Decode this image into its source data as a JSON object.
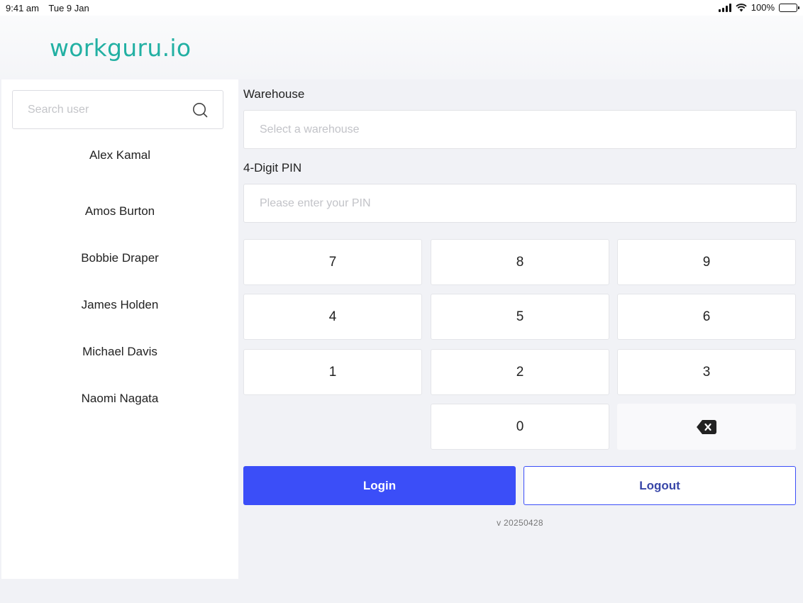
{
  "status_bar": {
    "time": "9:41 am",
    "date": "Tue 9 Jan",
    "battery": "100%",
    "icons": [
      "signal-icon",
      "wifi-icon",
      "battery-icon"
    ]
  },
  "brand": {
    "logo": "workguru.io",
    "accent": "#22b0a3",
    "primary": "#3b4ef8"
  },
  "sidebar": {
    "search_placeholder": "Search user",
    "users": [
      "Alex Kamal",
      "Amos Burton",
      "Bobbie Draper",
      "James Holden",
      "Michael Davis",
      "Naomi Nagata"
    ]
  },
  "form": {
    "warehouse_label": "Warehouse",
    "warehouse_placeholder": "Select a warehouse",
    "pin_label": "4-Digit PIN",
    "pin_placeholder": "Please enter your PIN"
  },
  "keypad": {
    "keys": [
      "7",
      "8",
      "9",
      "4",
      "5",
      "6",
      "1",
      "2",
      "3",
      "0"
    ],
    "backspace_icon": "backspace-icon"
  },
  "actions": {
    "login": "Login",
    "logout": "Logout"
  },
  "version": "v 20250428"
}
